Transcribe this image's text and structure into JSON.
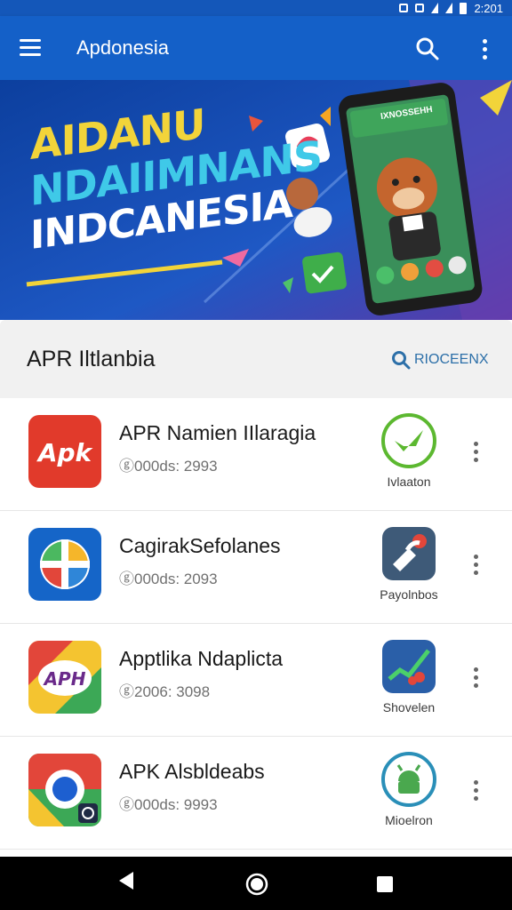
{
  "status": {
    "time": "2:201"
  },
  "appbar": {
    "title": "Apdonesia",
    "menu_icon": "hamburger-menu-icon",
    "search_icon": "search-icon",
    "more_icon": "more-vert-icon"
  },
  "banner": {
    "line1": "AIDANU",
    "line2": "NDAIIMNANS",
    "line3": "INDCANESIA",
    "phone_badge": "IXNOSSEHH"
  },
  "section": {
    "title": "APR Iltlanbia",
    "search_label": "RIOCEENX"
  },
  "apps": [
    {
      "title": "APR Namien IIlaragia",
      "subtitle": "ⓖ000ds: 2993",
      "action_label": "Ivlaaton",
      "action_icon": "check-badge-icon",
      "app_icon": "apk-logo-icon"
    },
    {
      "title": "CagirakSefolanes",
      "subtitle": "ⓖ000ds: 2093",
      "action_label": "Payolnbos",
      "action_icon": "wrench-badge-icon",
      "app_icon": "quadrant-badge-icon"
    },
    {
      "title": "Apptlika Ndaplicta",
      "subtitle": "ⓖ2006: 3098",
      "action_label": "Shovelen",
      "action_icon": "chart-badge-icon",
      "app_icon": "apk-swirl-icon"
    },
    {
      "title": "APK Alsbldeabs",
      "subtitle": "ⓖ000ds: 9993",
      "action_label": "Mioelron",
      "action_icon": "android-badge-icon",
      "app_icon": "chrome-like-icon"
    }
  ],
  "colors": {
    "appbar": "#1460c8",
    "accent_green": "#5cb830",
    "banner_yellow": "#f2d43a",
    "banner_cyan": "#3fc9e8"
  },
  "navbar": {
    "back_icon": "back-triangle-icon",
    "home_icon": "home-circle-icon",
    "recent_icon": "recents-square-icon"
  }
}
